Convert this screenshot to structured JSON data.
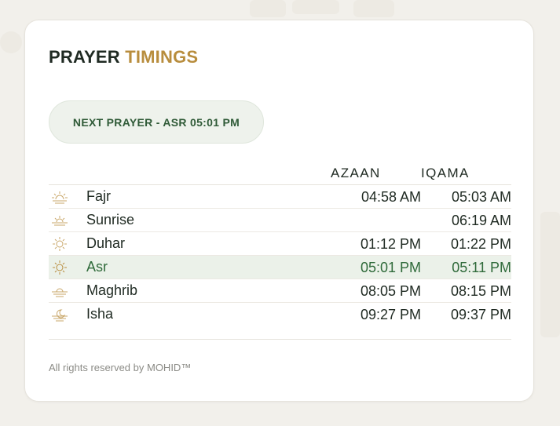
{
  "widget": {
    "title_part1": "PRAYER",
    "title_part2": "TIMINGS",
    "next_prayer": "NEXT PRAYER - ASR 05:01 PM",
    "columns": {
      "azaan": "AZAAN",
      "iqama": "IQAMA"
    },
    "prayers": [
      {
        "name": "Fajr",
        "azaan": "04:58 AM",
        "iqama": "05:03 AM",
        "icon": "sunrise-rays-icon"
      },
      {
        "name": "Sunrise",
        "azaan": "",
        "iqama": "06:19 AM",
        "icon": "sun-horizon-icon"
      },
      {
        "name": "Duhar",
        "azaan": "01:12 PM",
        "iqama": "01:22 PM",
        "icon": "sun-icon"
      },
      {
        "name": "Asr",
        "azaan": "05:01 PM",
        "iqama": "05:11 PM",
        "icon": "sun-icon",
        "active": true
      },
      {
        "name": "Maghrib",
        "azaan": "08:05 PM",
        "iqama": "08:15 PM",
        "icon": "sunset-icon"
      },
      {
        "name": "Isha",
        "azaan": "09:27 PM",
        "iqama": "09:37 PM",
        "icon": "moon-horizon-icon"
      }
    ],
    "footer": "All rights reserved by MOHID™"
  },
  "colors": {
    "accent_gold": "#b88d3d",
    "accent_green": "#2f6a3a",
    "highlight_bg": "#ebf1e9",
    "text_dark": "#1f2a22"
  }
}
